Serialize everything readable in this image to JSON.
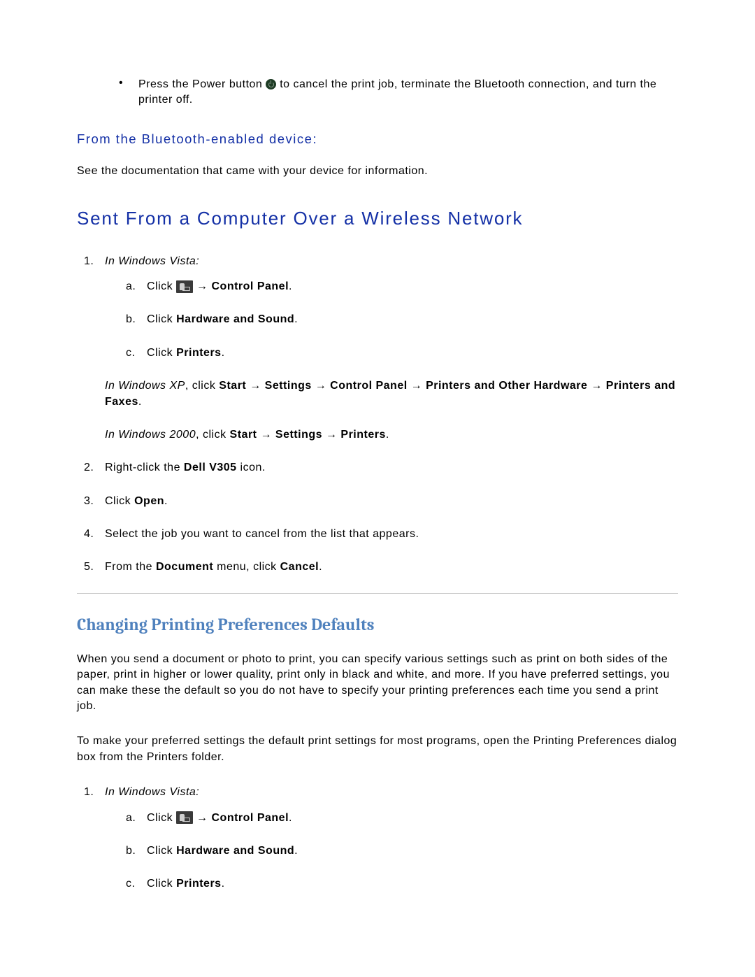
{
  "topBullet": {
    "pre": "Press the Power button ",
    "post": "to cancel the print job, terminate the Bluetooth connection, and turn the printer off."
  },
  "h3_bt": "From the Bluetooth-enabled device:",
  "p_bt": "See the documentation that came with your device for information.",
  "h2_wireless": "Sent From a Computer Over a Wireless Network",
  "vista_label": "In Windows Vista:",
  "vista_a_pre": "Click ",
  "vista_a_post": "Control Panel",
  "vista_b_pre": "Click ",
  "vista_b_post": "Hardware and Sound",
  "vista_c_pre": "Click ",
  "vista_c_post": "Printers",
  "xp_pre": "In Windows XP",
  "xp_text1": ", click ",
  "xp_start": "Start",
  "xp_arrow": " → ",
  "xp_settings": "Settings",
  "xp_cp": "Control Panel",
  "xp_poh": "Printers and Other Hardware",
  "xp_pf": "Printers and Faxes",
  "w2k_pre": "In Windows 2000",
  "w2k_text1": ", click ",
  "w2k_start": "Start",
  "w2k_settings": "Settings",
  "w2k_printers": "Printers",
  "step2_pre": "Right-click the ",
  "step2_bold": "Dell V305",
  "step2_post": " icon.",
  "step3_pre": "Click ",
  "step3_bold": "Open",
  "step4": "Select the job you want to cancel from the list that appears.",
  "step5_pre": "From the ",
  "step5_bold1": "Document",
  "step5_mid": " menu, click ",
  "step5_bold2": "Cancel",
  "h_prefs": "Changing Printing Preferences Defaults",
  "p_prefs1": "When you send a document or photo to print, you can specify various settings such as print on both sides of the paper, print in higher or lower quality, print only in black and white, and more. If you have preferred settings, you can make these the default so you do not have to specify your printing preferences each time you send a print job.",
  "p_prefs2": "To make your preferred settings the default print settings for most programs, open the Printing Preferences dialog box from the Printers folder.",
  "period": "."
}
